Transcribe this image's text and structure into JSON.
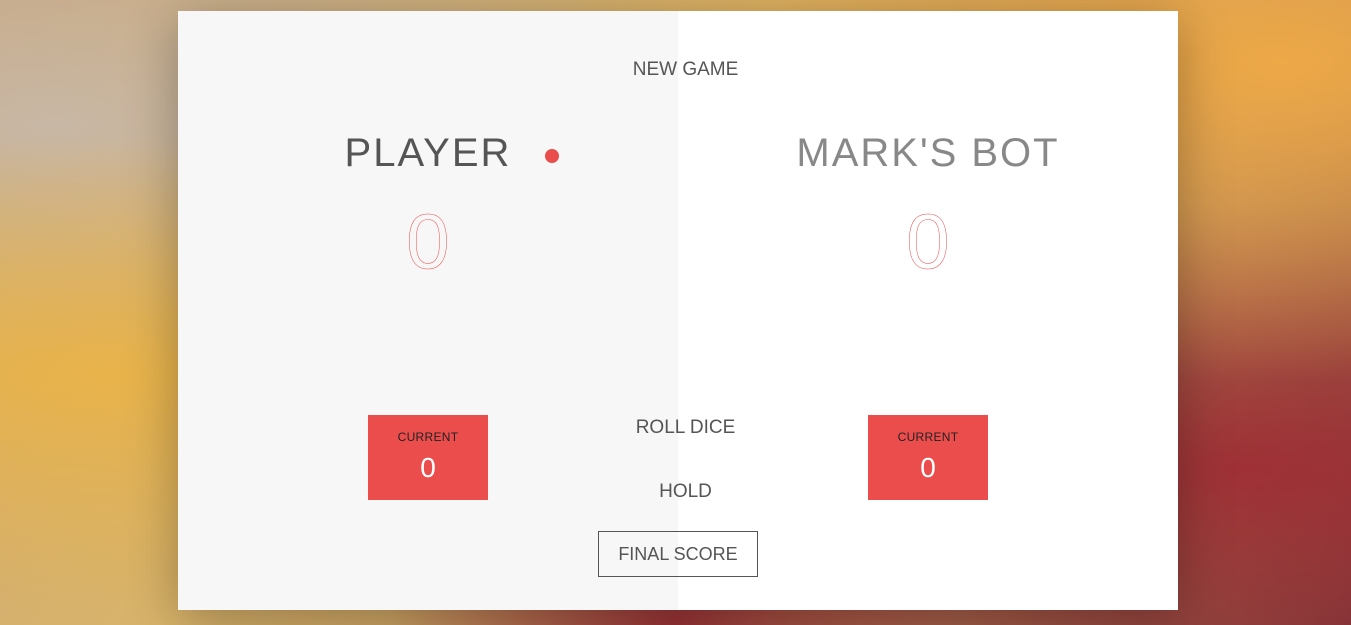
{
  "controls": {
    "new_game": "NEW GAME",
    "roll_dice": "ROLL DICE",
    "hold": "HOLD",
    "final_score_placeholder": "FINAL SCORE"
  },
  "players": [
    {
      "name": "PLAYER",
      "score": "0",
      "current_label": "CURRENT",
      "current_score": "0",
      "active": true
    },
    {
      "name": "MARK'S BOT",
      "score": "0",
      "current_label": "CURRENT",
      "current_score": "0",
      "active": false
    }
  ],
  "colors": {
    "accent": "#eb4d4d",
    "left_panel": "#f7f7f7",
    "right_panel": "#ffffff",
    "text": "#555555"
  },
  "icons": {
    "active_indicator": "red-dot-icon"
  }
}
